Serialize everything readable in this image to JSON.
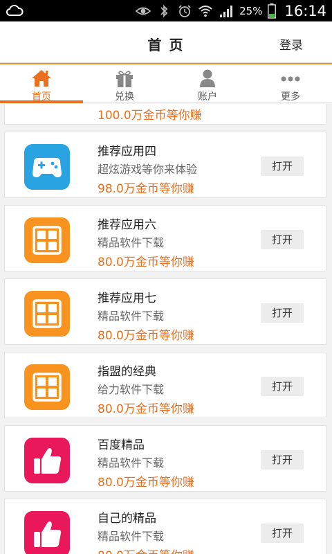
{
  "status_bar": {
    "battery": "25%",
    "time": "16:14",
    "icons": [
      "cloud-icon",
      "eye-icon",
      "bluetooth-icon",
      "alarm-icon",
      "wifi-icon",
      "signal-icon",
      "battery-icon"
    ]
  },
  "header": {
    "title": "首 页",
    "login_label": "登录"
  },
  "tabs": [
    {
      "label": "首页",
      "icon": "home-icon",
      "active": true
    },
    {
      "label": "兑换",
      "icon": "gift-icon",
      "active": false
    },
    {
      "label": "账户",
      "icon": "user-icon",
      "active": false
    },
    {
      "label": "更多",
      "icon": "more-icon",
      "active": false
    }
  ],
  "apps": [
    {
      "name": "",
      "desc": "",
      "reward": "100.0万金币等你赚",
      "icon": "grid-icon",
      "color": "#f7931e",
      "button": ""
    },
    {
      "name": "推荐应用四",
      "desc": "超炫游戏等你来体验",
      "reward": "98.0万金币等你赚",
      "icon": "gamepad-icon",
      "color": "#29a3e2",
      "button": "打开"
    },
    {
      "name": "推荐应用六",
      "desc": "精品软件下载",
      "reward": "80.0万金币等你赚",
      "icon": "grid-icon",
      "color": "#f7931e",
      "button": "打开"
    },
    {
      "name": "推荐应用七",
      "desc": "精品软件下载",
      "reward": "80.0万金币等你赚",
      "icon": "grid-icon",
      "color": "#f7931e",
      "button": "打开"
    },
    {
      "name": "指盟的经典",
      "desc": "给力软件下载",
      "reward": "80.0万金币等你赚",
      "icon": "grid-icon",
      "color": "#f7931e",
      "button": "打开"
    },
    {
      "name": "百度精品",
      "desc": "精品软件下载",
      "reward": "80.0万金币等你赚",
      "icon": "thumbs-up-icon",
      "color": "#e8185a",
      "button": "打开"
    },
    {
      "name": "自己的精品",
      "desc": "精品软件下载",
      "reward": "80.0万金币等你赚",
      "icon": "thumbs-up-icon",
      "color": "#e8185a",
      "button": "打开"
    }
  ],
  "colors": {
    "accent": "#e8701f",
    "status_bar": "#000000"
  }
}
